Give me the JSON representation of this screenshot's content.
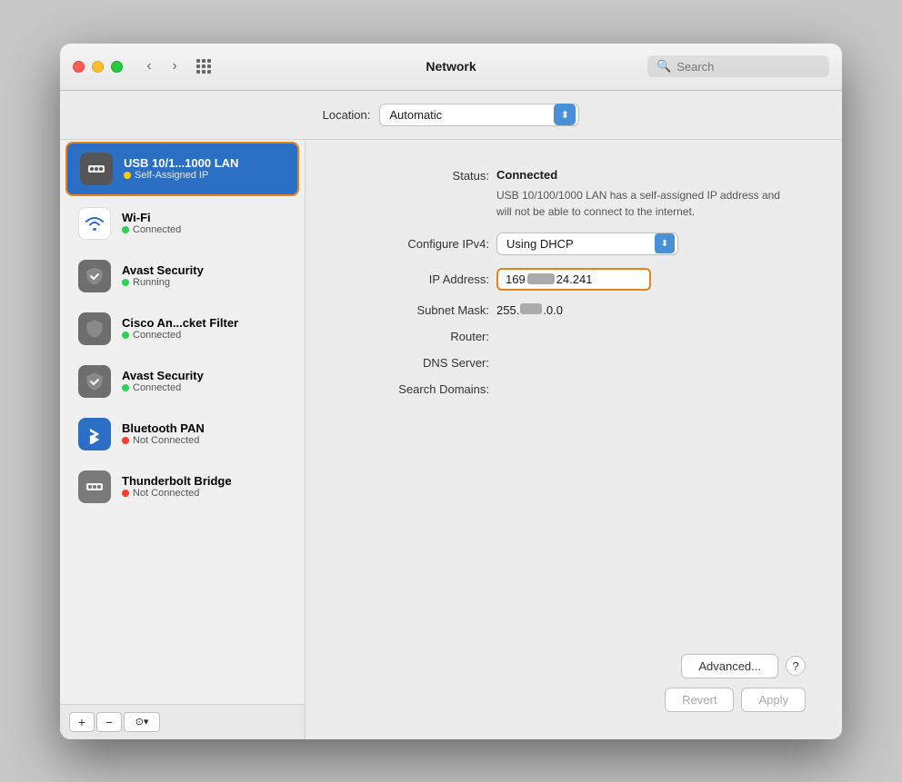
{
  "window": {
    "title": "Network"
  },
  "titlebar": {
    "back_label": "‹",
    "forward_label": "›",
    "search_placeholder": "Search"
  },
  "location": {
    "label": "Location:",
    "value": "Automatic"
  },
  "sidebar": {
    "items": [
      {
        "id": "usb",
        "name": "USB 10/1...1000 LAN",
        "status": "Self-Assigned IP",
        "status_type": "yellow",
        "active": true
      },
      {
        "id": "wifi",
        "name": "Wi-Fi",
        "status": "Connected",
        "status_type": "green",
        "active": false
      },
      {
        "id": "avast1",
        "name": "Avast Security",
        "status": "Running",
        "status_type": "green",
        "active": false
      },
      {
        "id": "cisco",
        "name": "Cisco An...cket Filter",
        "status": "Connected",
        "status_type": "green",
        "active": false
      },
      {
        "id": "avast2",
        "name": "Avast Security",
        "status": "Connected",
        "status_type": "green",
        "active": false
      },
      {
        "id": "bluetooth",
        "name": "Bluetooth PAN",
        "status": "Not Connected",
        "status_type": "red",
        "active": false
      },
      {
        "id": "thunderbolt",
        "name": "Thunderbolt Bridge",
        "status": "Not Connected",
        "status_type": "red",
        "active": false
      }
    ],
    "toolbar": {
      "add_label": "+",
      "remove_label": "−",
      "options_label": "⊙▾"
    }
  },
  "detail": {
    "status_label": "Status:",
    "status_value": "Connected",
    "description": "USB 10/100/1000 LAN has a self-assigned IP address and will not be able to connect to the internet.",
    "configure_label": "Configure IPv4:",
    "configure_value": "Using DHCP",
    "ip_label": "IP Address:",
    "ip_prefix": "169",
    "ip_suffix": "24.241",
    "subnet_label": "Subnet Mask:",
    "subnet_prefix": "255.",
    "subnet_suffix": ".0.0",
    "router_label": "Router:",
    "router_value": "",
    "dns_label": "DNS Server:",
    "dns_value": "",
    "domains_label": "Search Domains:",
    "domains_value": "",
    "advanced_label": "Advanced...",
    "help_label": "?",
    "revert_label": "Revert",
    "apply_label": "Apply"
  }
}
